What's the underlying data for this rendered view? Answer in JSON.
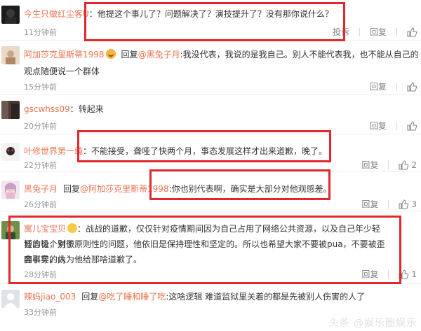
{
  "actions": {
    "reply": "回复",
    "report": "投诉",
    "reply_prefix": "回复",
    "at": "@"
  },
  "comments": [
    {
      "user": "今生只做红尘客U",
      "colon": "：",
      "text": "他提这个事儿了？问题解决了？演技提升了？没有那你说什么？",
      "time": "11分钟前",
      "likes": ""
    },
    {
      "user": "阿加莎克里斯蒂1998",
      "reply_to": "黑兔子月",
      "colon": ":",
      "text_line1": "我没代表，我说的是我自己。别人不能代表我，也不能从自己的",
      "text_line2": "观点随便说一个群体",
      "time": "15分钟前",
      "likes": ""
    },
    {
      "user": "gscwhss09",
      "colon": "：",
      "text": "转起来",
      "time": "20分钟前",
      "likes": ""
    },
    {
      "user": "叶修世界第一纯",
      "colon": "：",
      "text": "不能接受，聋哑了快两个月，事态发展这样才出来道歉，晚了。",
      "time": "22分钟前",
      "likes": "2"
    },
    {
      "user": "黑兔子月",
      "reply_to": "阿加莎克里斯蒂1998",
      "colon": ":",
      "text": "你也别代表啊，确实是大部分对他观感差。",
      "time": "26分钟前",
      "likes": "3"
    },
    {
      "user": "寓儿宝宝贝",
      "colon": "：",
      "text_line1": "战战的道歉，仅仅针对疫情期间因为自己占用了网络公共资源，以及自己年少轻狂的极个别微",
      "text_line2": "博言论，对于原则性的问题，他依旧是保持理性和坚定的。所以也希望大家不要被pua，不要被歪曲事实的内",
      "text_line3": "容引导，认为他给那啥道歉了。",
      "time": "28分钟前",
      "likes": "1"
    },
    {
      "user": "辣妈jiao_003",
      "reply_to": "吃了睡和睡了吃",
      "colon": ":",
      "text": "这啥逻辑 难道监狱里关着的都是先被别人伤害的人了",
      "time": "33分钟前",
      "likes": ""
    }
  ],
  "watermark": "头条 @娱乐圈娱乐"
}
